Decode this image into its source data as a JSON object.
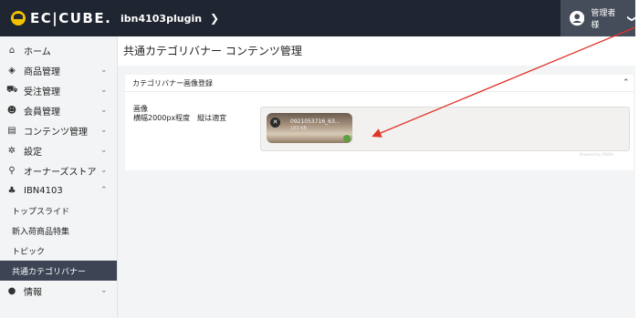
{
  "header": {
    "logo_text": "EC|CUBE.",
    "shop_name": "ibn4103plugin",
    "shop_chevron": "❯",
    "admin_name": "管理者 様",
    "admin_chevron": "❯"
  },
  "sidebar": {
    "items": [
      {
        "label": "ホーム",
        "icon": "home-icon"
      },
      {
        "label": "商品管理",
        "icon": "cube-icon"
      },
      {
        "label": "受注管理",
        "icon": "cart-icon"
      },
      {
        "label": "会員管理",
        "icon": "users-icon"
      },
      {
        "label": "コンテンツ管理",
        "icon": "file-icon"
      },
      {
        "label": "設定",
        "icon": "gear-icon"
      },
      {
        "label": "オーナーズストア",
        "icon": "plug-icon"
      },
      {
        "label": "IBN4103",
        "icon": "sitemap-icon"
      }
    ],
    "subitems": [
      {
        "label": "トップスライド"
      },
      {
        "label": "新入荷商品特集"
      },
      {
        "label": "トピック"
      },
      {
        "label": "共通カテゴリバナー"
      }
    ],
    "last_item": {
      "label": "情報",
      "icon": "info-icon"
    }
  },
  "main": {
    "page_title": "共通カテゴリバナー コンテンツ管理",
    "card_title": "カテゴリバナー画像登録",
    "field_label": "画像",
    "field_help": "横幅2000px程度　縦は適宜",
    "upload": {
      "filename": "0921053716_63...",
      "filesize": "183 KB",
      "powered_by": "Powered by PQINA"
    }
  },
  "colors": {
    "topbar": "#1f2531",
    "admin_bg": "#454d5a",
    "sidebar_active": "#3d4555",
    "arrow": "#e0332a"
  }
}
